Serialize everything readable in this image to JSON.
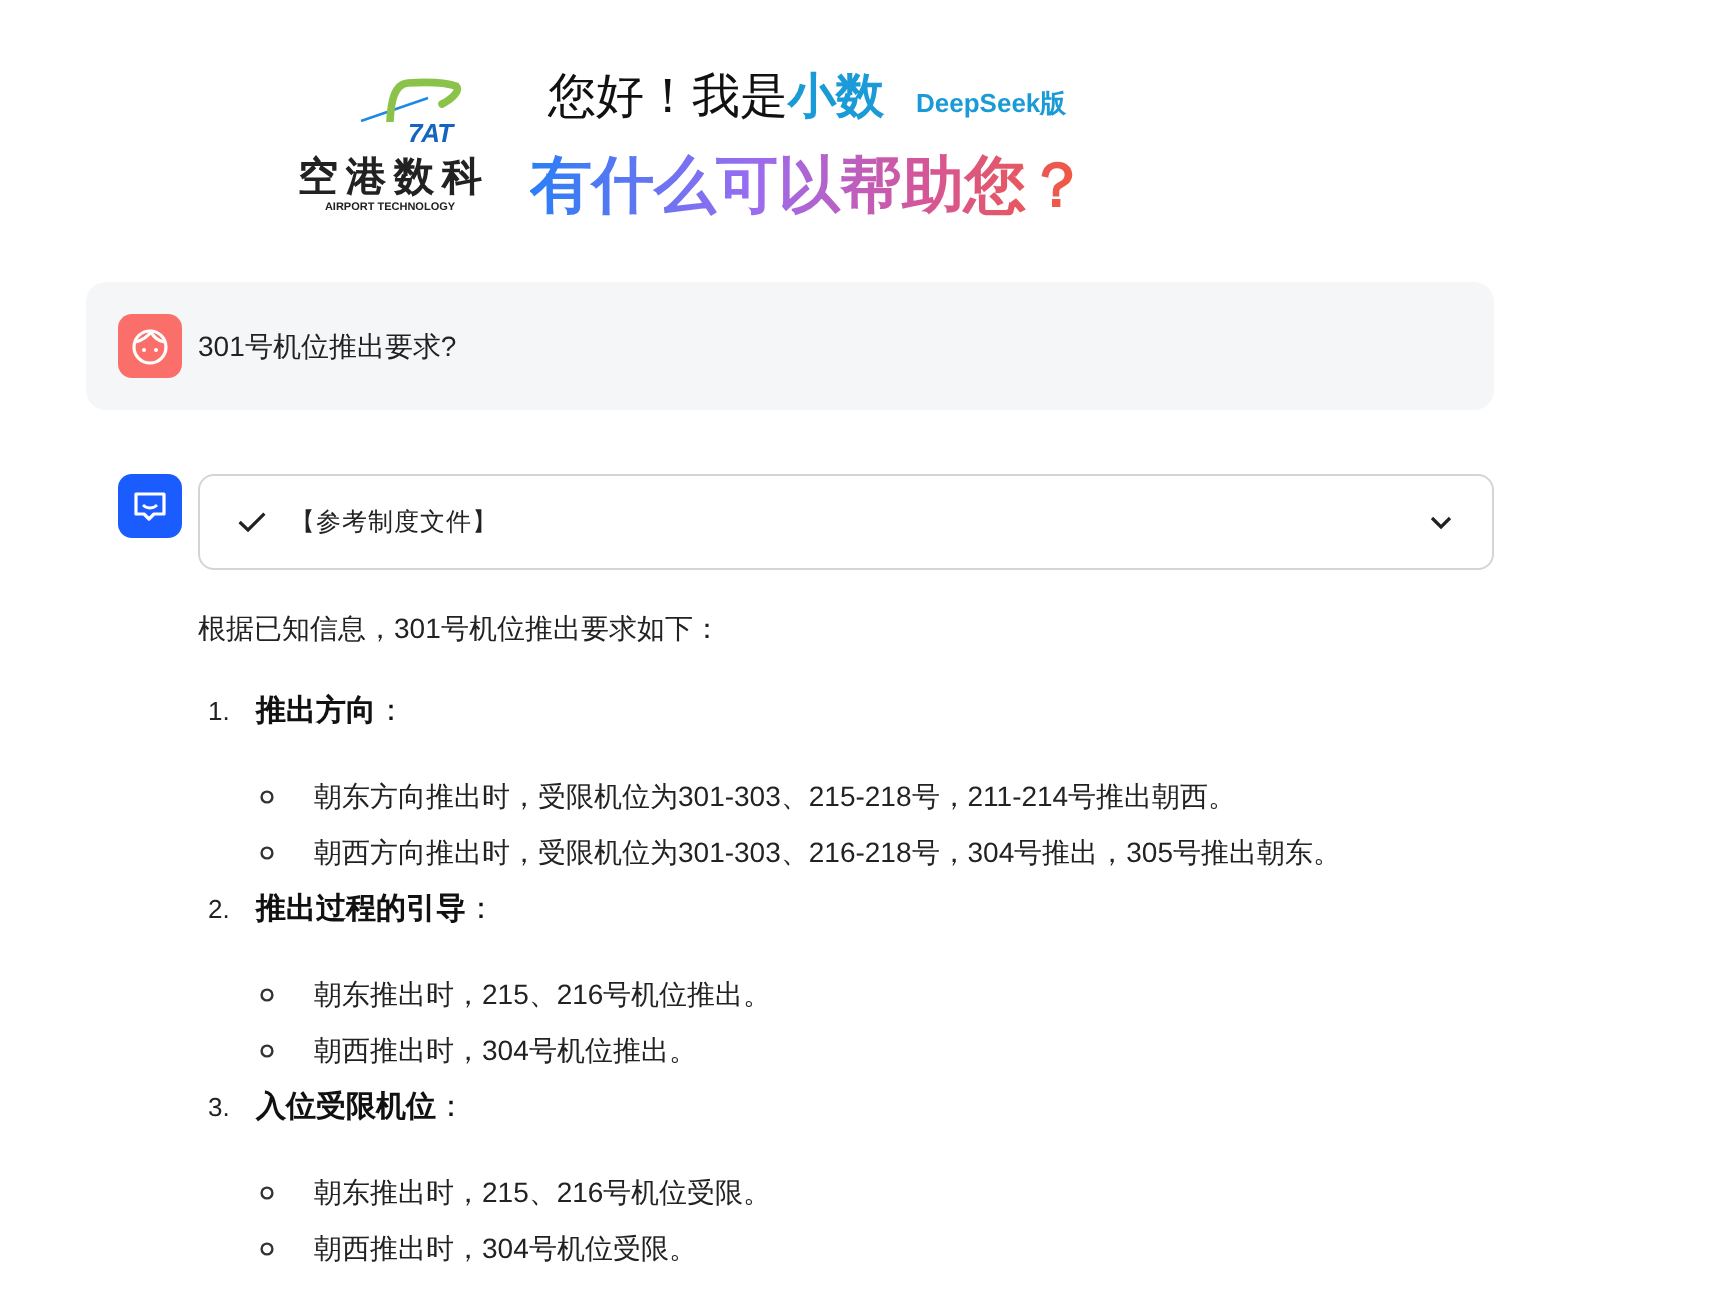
{
  "header": {
    "logo": {
      "mark": "7AT",
      "name": "空港数科",
      "tagline": "AIRPORT TECHNOLOGY"
    },
    "greeting": "您好！我是",
    "assistant_name": "小数",
    "edition_badge": "DeepSeek版",
    "subtitle": "有什么可以帮助您？"
  },
  "messages": [
    {
      "kind": "user",
      "text": "301号机位推出要求?"
    },
    {
      "kind": "assistant",
      "reference": {
        "label": "【参考制度文件】",
        "done": true,
        "expanded": false
      },
      "intro": "根据已知信息，301号机位推出要求如下：",
      "items": [
        {
          "number": "1.",
          "title": "**推出方向**：",
          "children": [
            {
              "text": "朝东方向推出时，受限机位为301-303、215-218号，211-214号推出朝西。"
            },
            {
              "text": "朝西方向推出时，受限机位为301-303、216-218号，304号推出，305号推出朝东。"
            }
          ]
        },
        {
          "number": "2.",
          "title": "**推出过程的引导**：",
          "children": [
            {
              "text": "朝东推出时，215、216号机位推出。"
            },
            {
              "text": "朝西推出时，304号机位推出。"
            }
          ]
        },
        {
          "number": "3.",
          "title": "**入位受限机位**：",
          "children": [
            {
              "text": "朝东推出时，215、216号机位受限。"
            },
            {
              "text": "朝西推出时，304号机位受限。"
            }
          ]
        }
      ]
    }
  ]
}
